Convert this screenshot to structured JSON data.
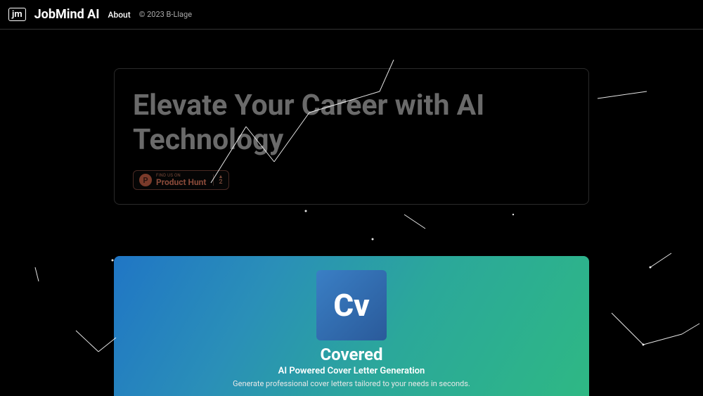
{
  "navbar": {
    "logo_text": "jm",
    "brand": "JobMind AI",
    "about": "About",
    "copyright": "© 2023 B-Llage"
  },
  "hero": {
    "title": "Elevate Your Career with AI Technology",
    "ph_small": "Find us on",
    "ph_main": "Product Hunt",
    "ph_letter": "P",
    "ph_num": "2"
  },
  "feature": {
    "icon_text": "Cv",
    "title": "Covered",
    "subtitle": "AI Powered Cover Letter Generation",
    "description": "Generate professional cover letters tailored to your needs in seconds."
  }
}
